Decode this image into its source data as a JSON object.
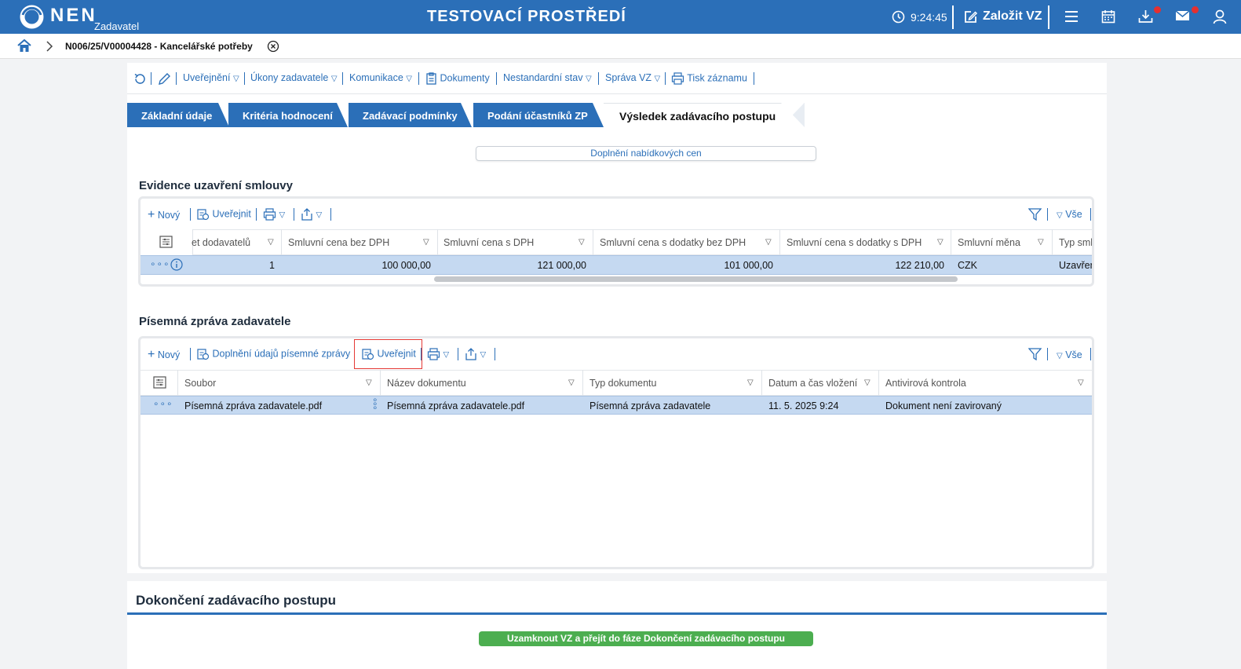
{
  "header": {
    "logo_text": "NEN",
    "logo_sub": "Zadavatel",
    "env_title": "TESTOVACÍ PROSTŘEDÍ",
    "clock": "9:24:45",
    "create_label": "Založit VZ",
    "accent": "#2b6fb8"
  },
  "breadcrumb": {
    "item": "N006/25/V00004428 - Kancelářské potřeby"
  },
  "toolbar": {
    "uverejneni": "Uveřejnění",
    "ukony": "Úkony zadavatele",
    "komunikace": "Komunikace",
    "dokumenty": "Dokumenty",
    "nestandardni": "Nestandardní stav",
    "sprava": "Správa VZ",
    "tisk": "Tisk záznamu"
  },
  "tabs": [
    {
      "label": "Základní údaje"
    },
    {
      "label": "Kritéria hodnocení"
    },
    {
      "label": "Zadávací podmínky"
    },
    {
      "label": "Podání účastníků ZP"
    },
    {
      "label": "Výsledek zadávacího postupu"
    }
  ],
  "doplneni_button": "Doplnění nabídkových cen",
  "contract": {
    "title": "Evidence uzavření smlouvy",
    "new": "Nový",
    "publish": "Uveřejnit",
    "all": "Vše",
    "columns": [
      "et dodavatelů",
      "Smluvní cena bez DPH",
      "Smluvní cena s DPH",
      "Smluvní cena s dodatky bez DPH",
      "Smluvní cena s dodatky s DPH",
      "Smluvní měna",
      "Typ sml"
    ],
    "row": [
      "1",
      "100 000,00",
      "121 000,00",
      "101 000,00",
      "122 210,00",
      "CZK",
      "Uzavřen"
    ]
  },
  "report": {
    "title": "Písemná zpráva zadavatele",
    "new": "Nový",
    "complete": "Doplnění údajů písemné zprávy",
    "publish": "Uveřejnit",
    "all": "Vše",
    "columns": [
      "Soubor",
      "Název dokumentu",
      "Typ dokumentu",
      "Datum a čas vložení",
      "Antivirová kontrola"
    ],
    "row": [
      "Písemná zpráva zadavatele.pdf",
      "Písemná zpráva zadavatele.pdf",
      "Písemná zpráva zadavatele",
      "11. 5. 2025 9:24",
      "Dokument není zavirovaný"
    ]
  },
  "final": {
    "title": "Dokončení zadávacího postupu",
    "lock_button": "Uzamknout VZ a přejít do fáze Dokončení zadávacího postupu"
  }
}
